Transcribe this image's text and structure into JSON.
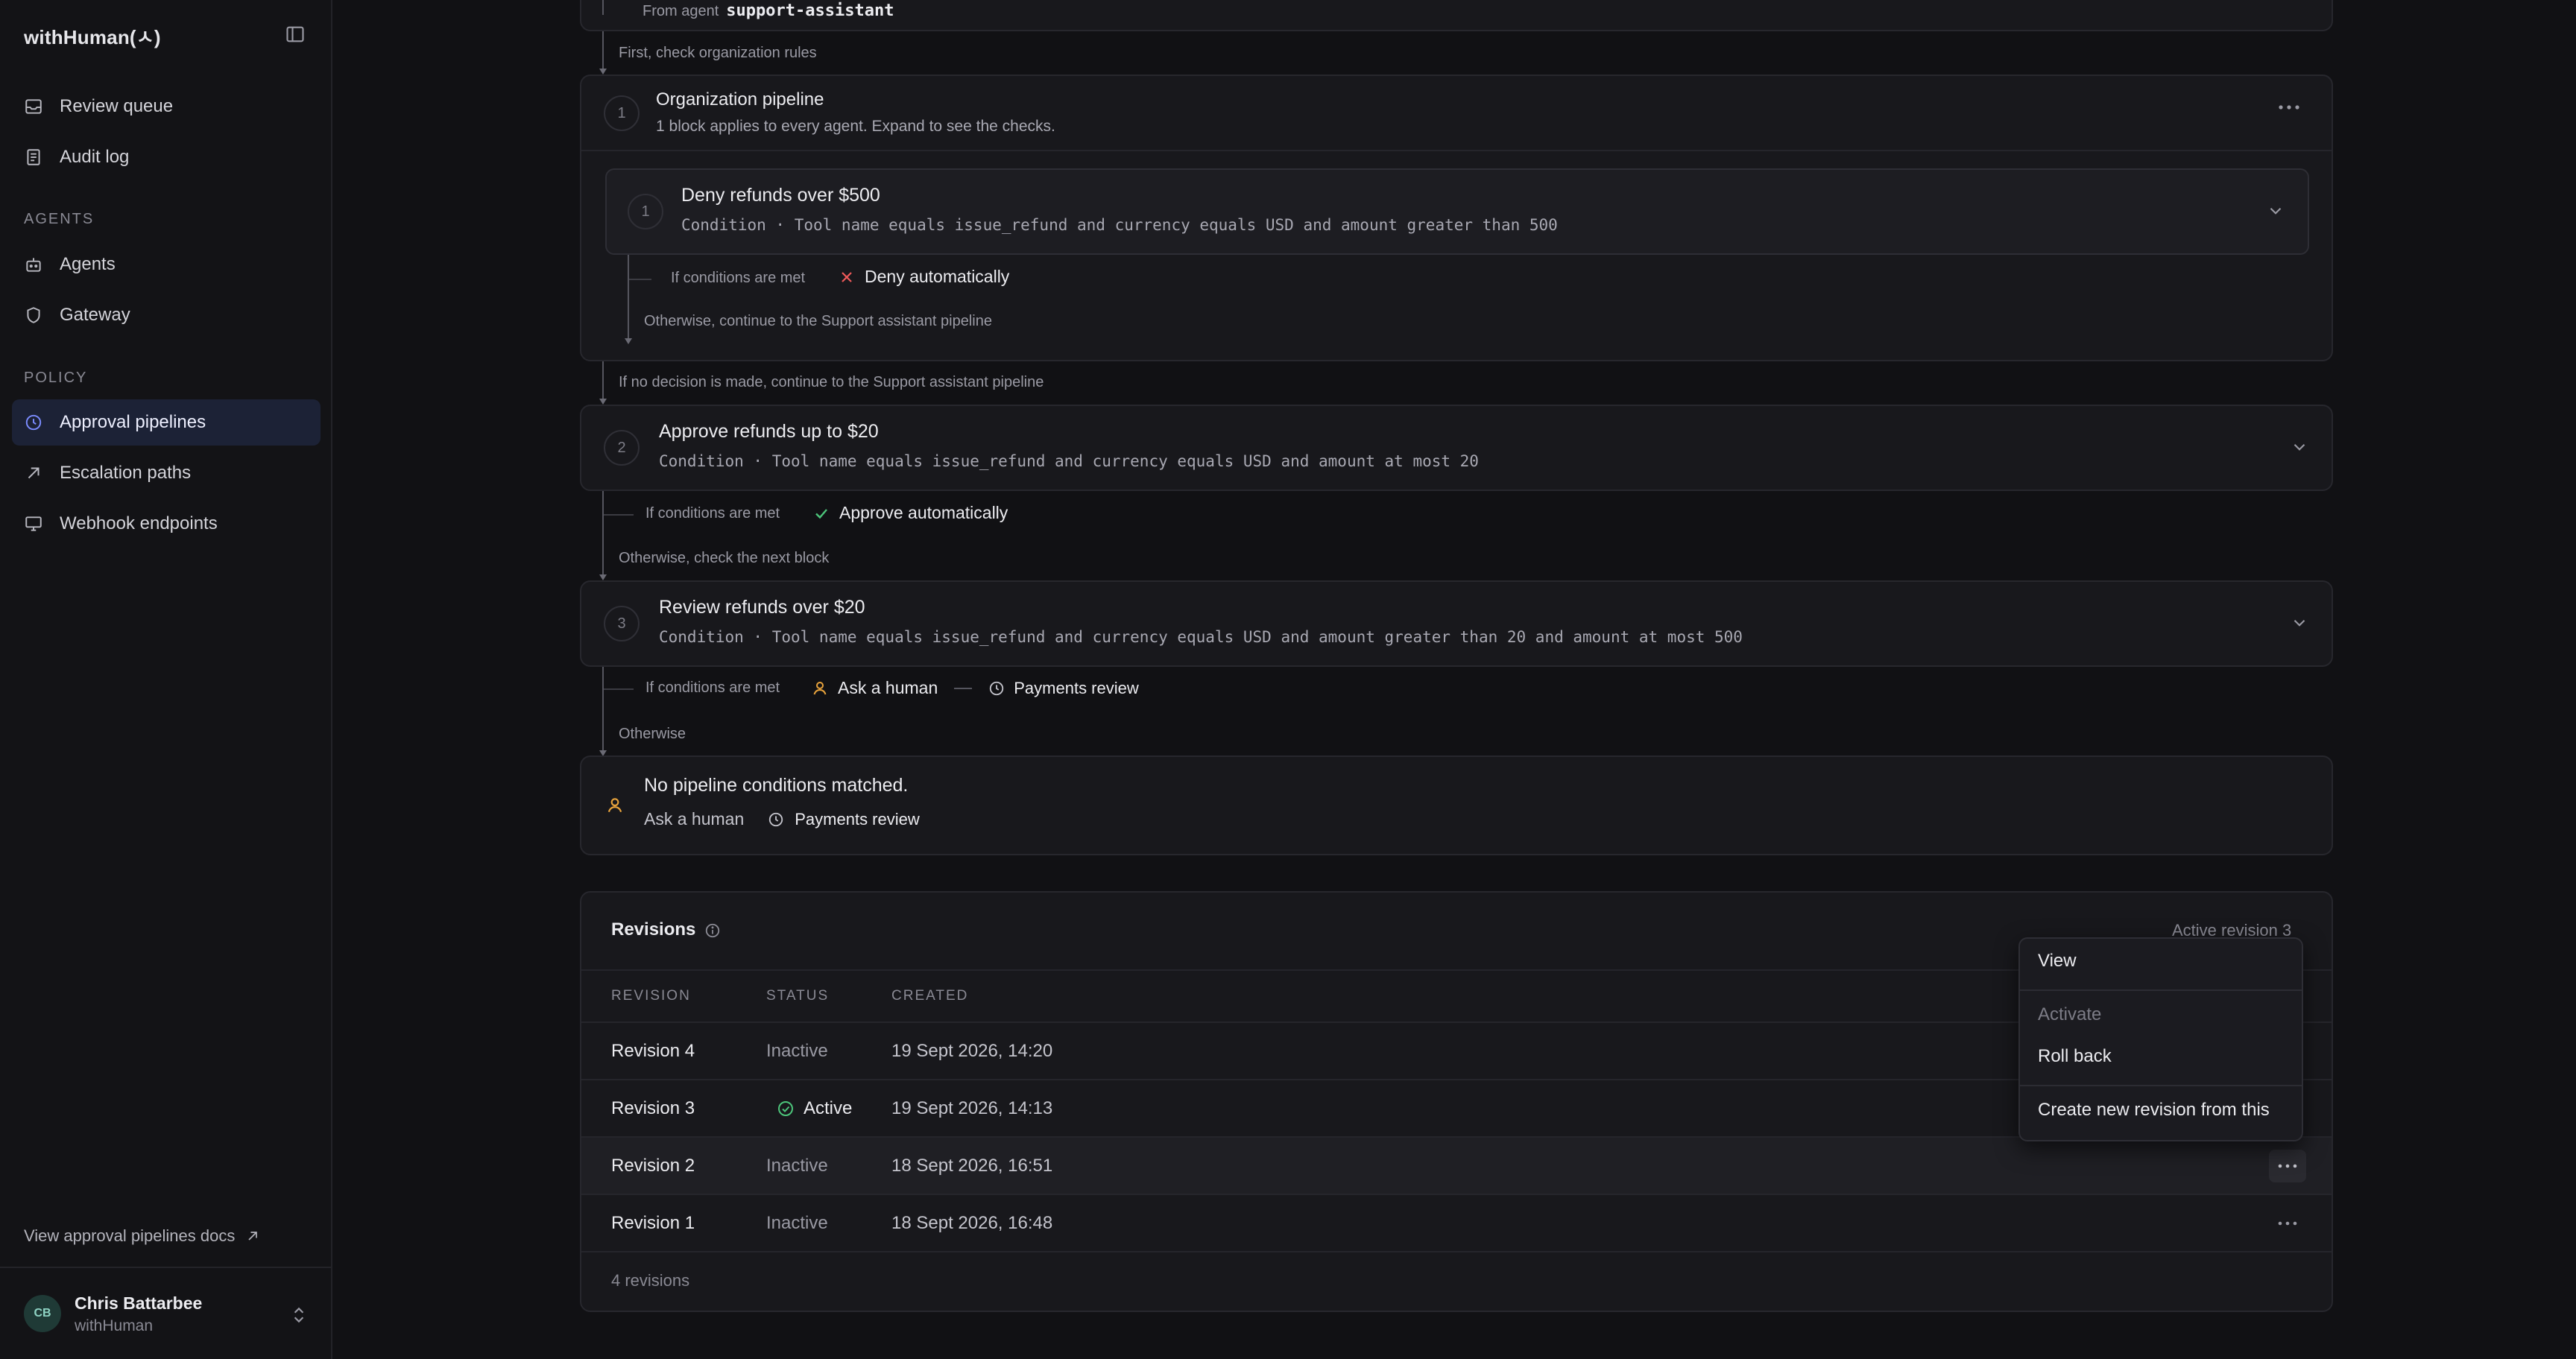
{
  "app": {
    "brand": "withHuman(ㅅ)"
  },
  "sidebar": {
    "top_items": [
      {
        "label": "Review queue",
        "icon": "inbox-icon"
      },
      {
        "label": "Audit log",
        "icon": "document-icon"
      }
    ],
    "agents_section": "AGENTS",
    "agents_items": [
      {
        "label": "Agents",
        "icon": "bot-icon"
      },
      {
        "label": "Gateway",
        "icon": "shield-icon"
      }
    ],
    "policy_section": "POLICY",
    "policy_items": [
      {
        "label": "Approval pipelines",
        "icon": "pipeline-icon",
        "active": true
      },
      {
        "label": "Escalation paths",
        "icon": "arrow-up-right-icon"
      },
      {
        "label": "Webhook endpoints",
        "icon": "monitor-icon"
      }
    ],
    "docs_link": "View approval pipelines docs",
    "user": {
      "initials": "CB",
      "name": "Chris Battarbee",
      "org": "withHuman"
    }
  },
  "pipeline": {
    "origin": {
      "prefix": "From agent",
      "agent": "support-assistant"
    },
    "connector_org": "First, check organization rules",
    "org_block": {
      "number": "1",
      "title": "Organization pipeline",
      "subtitle": "1 block applies to every agent. Expand to see the checks.",
      "inner": {
        "number": "1",
        "title": "Deny refunds over $500",
        "condition": "Condition · Tool name equals issue_refund and currency equals USD and amount greater than 500",
        "if_label": "If conditions are met",
        "outcome": "Deny automatically",
        "otherwise": "Otherwise, continue to the Support assistant pipeline"
      }
    },
    "connector_after_org": "If no decision is made, continue to the Support assistant pipeline",
    "block2": {
      "number": "2",
      "title": "Approve refunds up to $20",
      "condition": "Condition · Tool name equals issue_refund and currency equals USD and amount at most 20",
      "if_label": "If conditions are met",
      "outcome": "Approve automatically",
      "otherwise": "Otherwise, check the next block"
    },
    "block3": {
      "number": "3",
      "title": "Review refunds over $20",
      "condition": "Condition · Tool name equals issue_refund and currency equals USD and amount greater than 20 and amount at most 500",
      "if_label": "If conditions are met",
      "outcome": "Ask a human",
      "queue": "Payments review",
      "otherwise": "Otherwise"
    },
    "fallback": {
      "title": "No pipeline conditions matched.",
      "outcome": "Ask a human",
      "queue": "Payments review"
    }
  },
  "revisions": {
    "title": "Revisions",
    "active_label": "Active revision 3",
    "columns": [
      "REVISION",
      "STATUS",
      "CREATED"
    ],
    "rows": [
      {
        "name": "Revision 4",
        "status": "Inactive",
        "created": "19 Sept 2026, 14:20"
      },
      {
        "name": "Revision 3",
        "status": "Active",
        "created": "19 Sept 2026, 14:13"
      },
      {
        "name": "Revision 2",
        "status": "Inactive",
        "created": "18 Sept 2026, 16:51"
      },
      {
        "name": "Revision 1",
        "status": "Inactive",
        "created": "18 Sept 2026, 16:48"
      }
    ],
    "footer": "4 revisions",
    "menu": {
      "view": "View",
      "activate": "Activate",
      "rollback": "Roll back",
      "create": "Create new revision from this"
    }
  },
  "colors": {
    "accent": "#7b8cff",
    "deny": "#f05a5a",
    "approve": "#4cc47a",
    "human": "#e8a33c",
    "active_nav_bg": "#1c2236"
  }
}
